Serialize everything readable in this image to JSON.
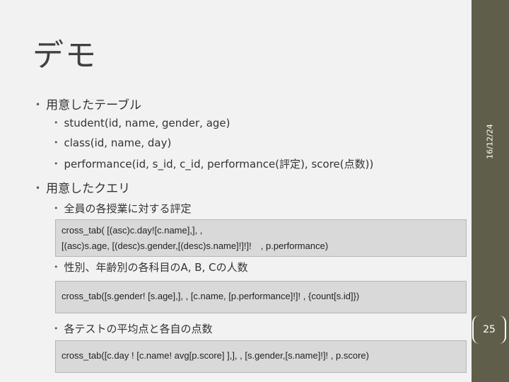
{
  "slide": {
    "title": "デモ",
    "date": "16/12/24",
    "page_number": "25"
  },
  "content": {
    "bullet1": "用意したテーブル",
    "tables": [
      "student(id, name, gender, age)",
      "class(id, name, day)",
      "performance(id, s_id, c_id, performance(評定), score(点数))"
    ],
    "bullet2": "用意したクエリ",
    "query1_desc": "全員の各授業に対する評定",
    "query1_code_line1": "cross_tab( [(asc)c.day![c.name],], ,",
    "query1_code_line2": "[(asc)s.age, [(desc)s.gender,[(desc)s.name]!]!]!　, p.performance)",
    "query2_desc": "性別、年齢別の各科目のA, B, Cの人数",
    "query2_code": "cross_tab([s.gender! [s.age],], , [c.name, [p.performance]!]! , {count[s.id]})",
    "query3_desc": "各テストの平均点と各自の点数",
    "query3_code": "cross_tab([c.day ! [c.name! avg[p.score] ],], , [s.gender,[s.name]!]! , p.score)"
  }
}
